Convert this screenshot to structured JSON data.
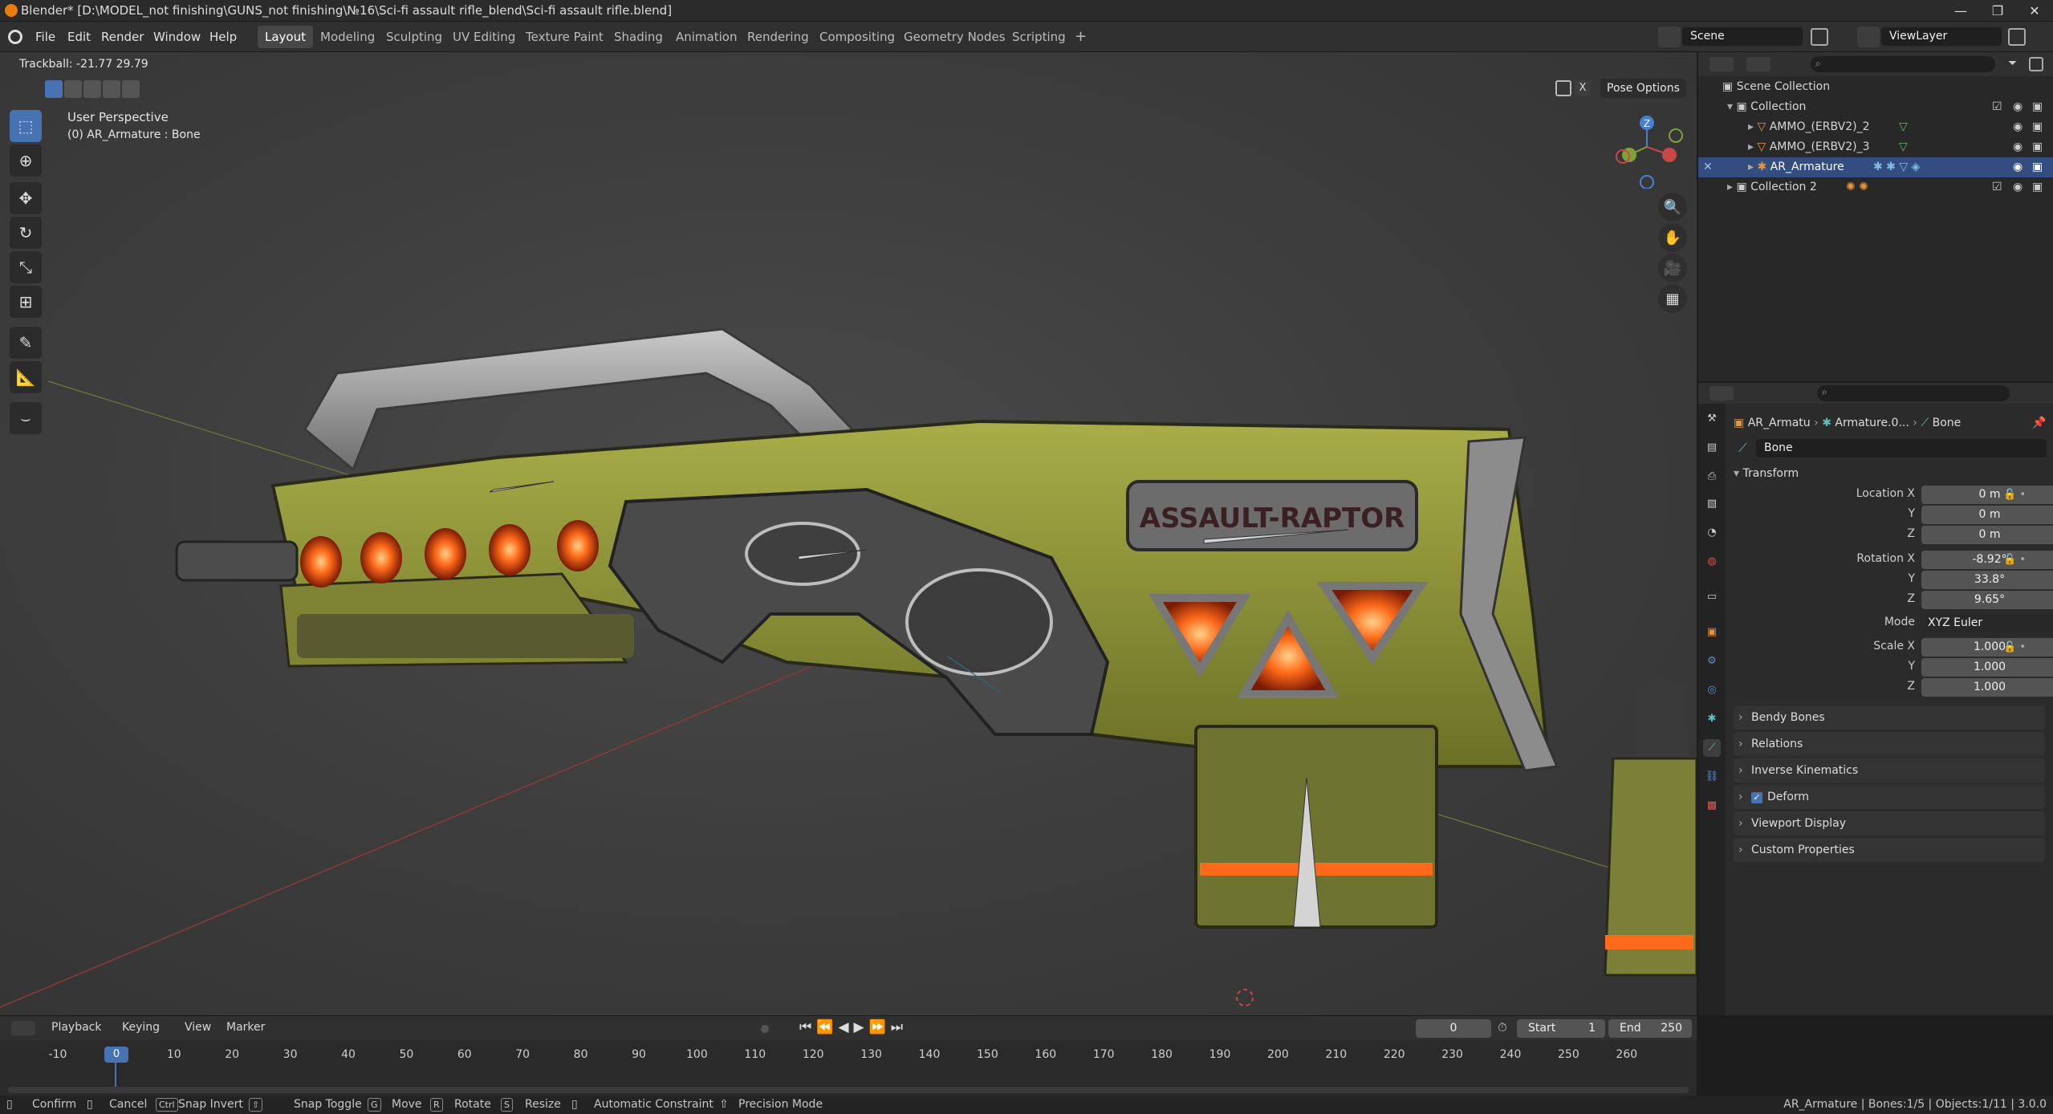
{
  "titlebar": {
    "title": "Blender* [D:\\MODEL_not finishing\\GUNS_not finishing\\№16\\Sci-fi assault rifle_blend\\Sci-fi assault rifle.blend]",
    "minimize": "—",
    "maximize": "❐",
    "close": "✕"
  },
  "menubar": {
    "menus": [
      "File",
      "Edit",
      "Render",
      "Window",
      "Help"
    ],
    "workspaces": [
      "Layout",
      "Modeling",
      "Sculpting",
      "UV Editing",
      "Texture Paint",
      "Shading",
      "Animation",
      "Rendering",
      "Compositing",
      "Geometry Nodes",
      "Scripting"
    ],
    "add_label": "+",
    "scene_label": "Scene",
    "viewlayer_label": "ViewLayer"
  },
  "viewport": {
    "operator_info": "Trackball: -21.77 29.79",
    "perspective": "User Perspective",
    "active_bone": "(0) AR_Armature : Bone",
    "pose_options": "Pose Options",
    "axis_z": "Z",
    "weapon_decal": "ASSAULT-RAPTOR"
  },
  "outliner": {
    "scene_collection": "Scene Collection",
    "collection": "Collection",
    "items": [
      "AMMO_(ERBV2)_2",
      "AMMO_(ERBV2)_3",
      "AR_Armature"
    ],
    "collection2": "Collection 2"
  },
  "properties": {
    "breadcrumb": [
      "AR_Armatu",
      "Armature.0...",
      "Bone"
    ],
    "bone_name": "Bone",
    "transform_title": "Transform",
    "location": {
      "label": "Location X",
      "x": "0 m",
      "y": "0 m",
      "z": "0 m"
    },
    "rotation": {
      "label": "Rotation X",
      "x": "-8.92°",
      "y": "33.8°",
      "z": "9.65°"
    },
    "axis_y": "Y",
    "axis_z": "Z",
    "mode_label": "Mode",
    "mode_value": "XYZ Euler",
    "scale": {
      "label": "Scale X",
      "x": "1.000",
      "y": "1.000",
      "z": "1.000"
    },
    "panels": [
      "Bendy Bones",
      "Relations",
      "Inverse Kinematics",
      "Deform",
      "Viewport Display",
      "Custom Properties"
    ]
  },
  "timeline": {
    "menus": [
      "Playback",
      "Keying",
      "View",
      "Marker"
    ],
    "current_frame": "0",
    "start_label": "Start",
    "start_value": "1",
    "end_label": "End",
    "end_value": "250",
    "ticks": [
      "-10",
      "0",
      "10",
      "20",
      "30",
      "40",
      "50",
      "60",
      "70",
      "80",
      "90",
      "100",
      "110",
      "120",
      "130",
      "140",
      "150",
      "160",
      "170",
      "180",
      "190",
      "200",
      "210",
      "220",
      "230",
      "240",
      "250",
      "260"
    ],
    "playhead_label": "0"
  },
  "statusbar": {
    "hints": [
      "Confirm",
      "Cancel",
      "Snap Invert",
      "Snap Toggle",
      "Move",
      "Rotate",
      "Resize",
      "Automatic Constraint",
      "Precision Mode"
    ],
    "keys": [
      "Ctrl",
      "⇧",
      "G",
      "R",
      "S"
    ],
    "right_info": "AR_Armature | Bones:1/5 | Objects:1/11 | 3.0.0"
  },
  "colors": {
    "accent": "#4772b3",
    "selection": "#334d80",
    "glow": "#ff6a1a"
  }
}
